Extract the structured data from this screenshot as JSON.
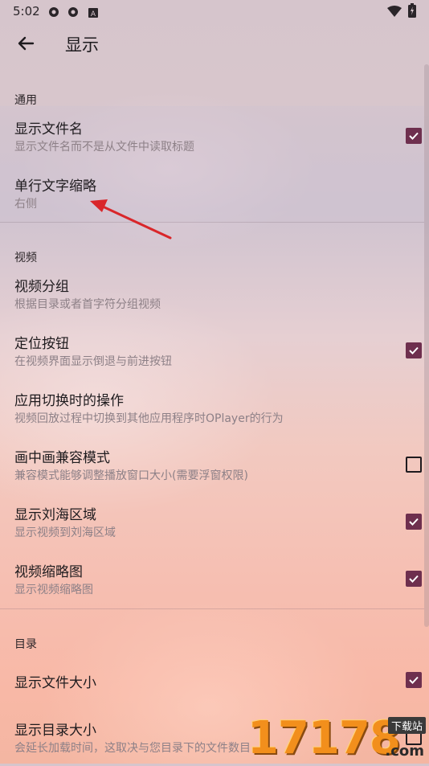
{
  "status_bar": {
    "time": "5:02",
    "icons": [
      "settings-gear-icon",
      "settings-gear-icon",
      "notification-a-icon",
      "wifi-icon",
      "battery-charging-icon"
    ]
  },
  "app_bar": {
    "title": "显示",
    "back_icon": "arrow-left-icon"
  },
  "sections": {
    "general": {
      "header": "通用",
      "items": [
        {
          "title": "显示文件名",
          "subtitle": "显示文件名而不是从文件中读取标题",
          "checked": true
        },
        {
          "title": "单行文字缩略",
          "subtitle": "右侧",
          "checked": null
        }
      ]
    },
    "video": {
      "header": "视频",
      "items": [
        {
          "title": "视频分组",
          "subtitle": "根据目录或者首字符分组视频",
          "checked": null
        },
        {
          "title": "定位按钮",
          "subtitle": "在视频界面显示倒退与前进按钮",
          "checked": true
        },
        {
          "title": "应用切换时的操作",
          "subtitle": "视频回放过程中切换到其他应用程序时OPlayer的行为",
          "checked": null
        },
        {
          "title": "画中画兼容模式",
          "subtitle": "兼容模式能够调整播放窗口大小(需要浮窗权限)",
          "checked": false
        },
        {
          "title": "显示刘海区域",
          "subtitle": "显示视频到刘海区域",
          "checked": true
        },
        {
          "title": "视频缩略图",
          "subtitle": "显示视频缩略图",
          "checked": true
        }
      ]
    },
    "directory": {
      "header": "目录",
      "items": [
        {
          "title": "显示文件大小",
          "subtitle": "",
          "checked": true
        },
        {
          "title": "显示目录大小",
          "subtitle": "会延长加载时间，这取决与您目录下的文件数目",
          "checked": false
        }
      ]
    }
  },
  "watermark": {
    "text": "17178",
    "badge": "下载站",
    "domain": ".com"
  },
  "colors": {
    "accent": "#6e2f4e",
    "annotation_arrow": "#d9262a"
  }
}
